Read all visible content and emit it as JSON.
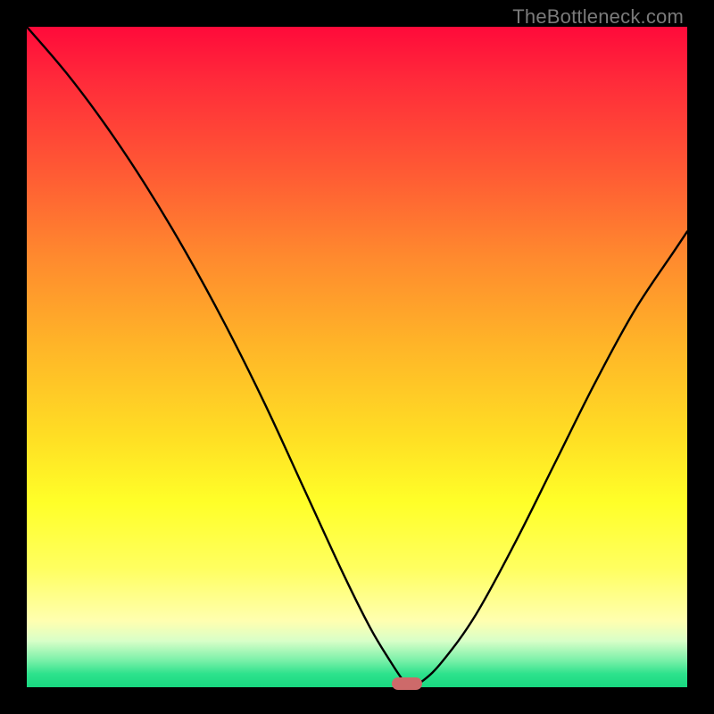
{
  "watermark": "TheBottleneck.com",
  "chart_data": {
    "type": "line",
    "title": "",
    "xlabel": "",
    "ylabel": "",
    "xlim": [
      0,
      100
    ],
    "ylim": [
      0,
      100
    ],
    "grid": false,
    "series": [
      {
        "name": "bottleneck-curve",
        "x": [
          0,
          6,
          12,
          18,
          24,
          30,
          36,
          42,
          48,
          52,
          55,
          57,
          58,
          60,
          63,
          68,
          74,
          80,
          86,
          92,
          98,
          100
        ],
        "values": [
          100,
          93,
          85,
          76,
          66,
          55,
          43,
          30,
          17,
          9,
          4,
          1,
          0,
          1,
          4,
          11,
          22,
          34,
          46,
          57,
          66,
          69
        ]
      }
    ],
    "marker": {
      "x": 57.5,
      "y": 0.5,
      "color": "#cd6a6a"
    },
    "background_gradient": {
      "stops": [
        {
          "pos": 0.0,
          "color": "#ff0a3a"
        },
        {
          "pos": 0.35,
          "color": "#ff8a2e"
        },
        {
          "pos": 0.7,
          "color": "#ffff28"
        },
        {
          "pos": 0.93,
          "color": "#d8ffc8"
        },
        {
          "pos": 1.0,
          "color": "#18d880"
        }
      ]
    }
  }
}
